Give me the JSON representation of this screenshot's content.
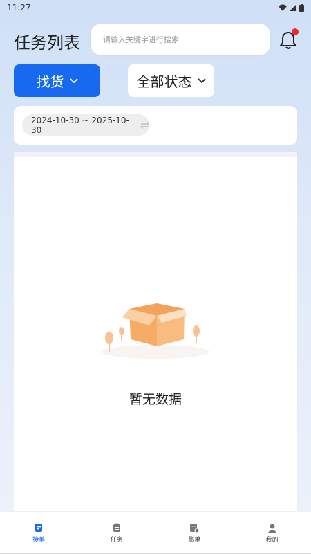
{
  "status_bar": {
    "time": "11:27",
    "icons": [
      "wifi-icon",
      "signal-icon",
      "battery-icon"
    ]
  },
  "header": {
    "title": "任务列表",
    "search_placeholder": "请输入关键字进行搜索",
    "bell_icon": "bell-icon",
    "has_notification": true
  },
  "filters": {
    "type_label": "找货",
    "status_label": "全部状态",
    "date_range": "2024-10-30 ~ 2025-10-30",
    "swap_icon": "swap-icon"
  },
  "content": {
    "empty_text": "暂无数据",
    "empty_icon": "empty-box-icon"
  },
  "tabbar": {
    "items": [
      {
        "label": "接单",
        "icon": "order-icon",
        "active": true
      },
      {
        "label": "任务",
        "icon": "task-icon",
        "active": false
      },
      {
        "label": "账单",
        "icon": "bill-icon",
        "active": false
      },
      {
        "label": "我的",
        "icon": "profile-icon",
        "active": false
      }
    ]
  },
  "colors": {
    "primary": "#1769f0",
    "badge": "#f2272e",
    "box": "#f6a95d"
  }
}
